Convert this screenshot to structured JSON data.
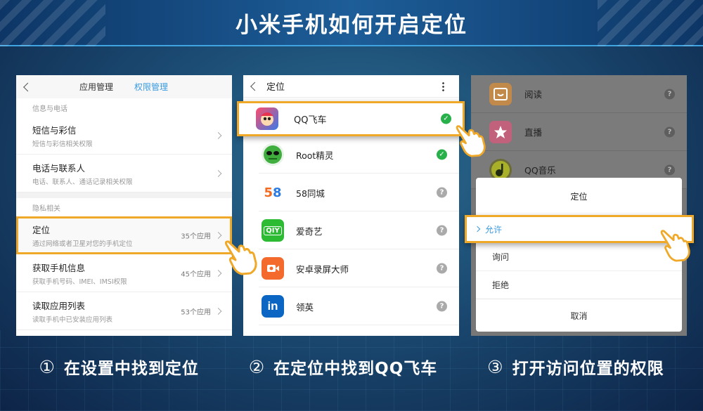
{
  "title": "小米手机如何开启定位",
  "panel1": {
    "tabs": [
      "应用管理",
      "权限管理"
    ],
    "section1": "信息与电话",
    "rows_a": [
      {
        "title": "短信与彩信",
        "sub": "短信与彩信相关权限"
      },
      {
        "title": "电话与联系人",
        "sub": "电话、联系人、通话记录相关权限"
      }
    ],
    "section2": "隐私相关",
    "rows_b": [
      {
        "title": "定位",
        "sub": "通过网络或者卫星对您的手机定位",
        "count": "35个应用"
      },
      {
        "title": "获取手机信息",
        "sub": "获取手机号码、IMEI、IMSI权限",
        "count": "45个应用"
      },
      {
        "title": "读取应用列表",
        "sub": "读取手机中已安装应用列表",
        "count": "53个应用"
      }
    ]
  },
  "panel2": {
    "title": "定位",
    "apps": [
      {
        "name": "QQ飞车",
        "status": "allowed"
      },
      {
        "name": "Root精灵",
        "status": "allowed"
      },
      {
        "name": "58同城",
        "status": "ask"
      },
      {
        "name": "爱奇艺",
        "status": "ask"
      },
      {
        "name": "安卓录屏大师",
        "status": "ask"
      },
      {
        "name": "领英",
        "status": "ask"
      }
    ]
  },
  "panel3": {
    "apps": [
      {
        "name": "阅读"
      },
      {
        "name": "直播"
      },
      {
        "name": "QQ音乐"
      }
    ],
    "dialog": {
      "title": "定位",
      "options": [
        "允许",
        "询问",
        "拒绝"
      ],
      "cancel": "取消"
    }
  },
  "steps": [
    {
      "num": "①",
      "text": "在设置中找到定位"
    },
    {
      "num": "②",
      "text": "在定位中找到QQ飞车"
    },
    {
      "num": "③",
      "text": "打开访问位置的权限"
    }
  ],
  "colors": {
    "highlight": "#f0a828",
    "accent": "#3a9be0",
    "check": "#28b04a"
  }
}
